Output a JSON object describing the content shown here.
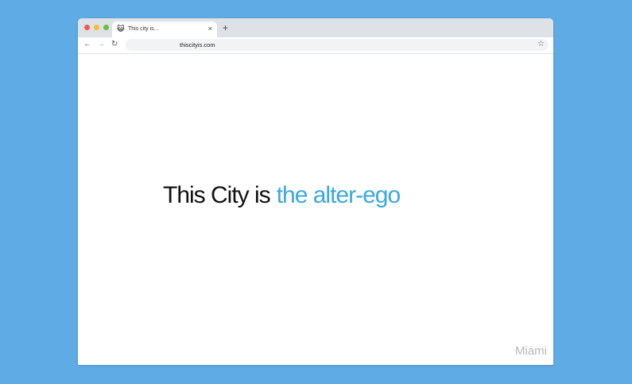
{
  "browser": {
    "tab": {
      "title": "This city is...",
      "favicon": "😺",
      "close": "×"
    },
    "new_tab": "+",
    "nav": {
      "back": "←",
      "forward": "→",
      "reload": "↻"
    },
    "url": "thiscityis.com",
    "bookmark": "☆"
  },
  "page": {
    "lead": "This City is",
    "accent": "the alter-ego",
    "city": "Miami"
  },
  "colors": {
    "background": "#5eabe6",
    "accent": "#3ba8e0",
    "city": "#b8b8b8"
  }
}
